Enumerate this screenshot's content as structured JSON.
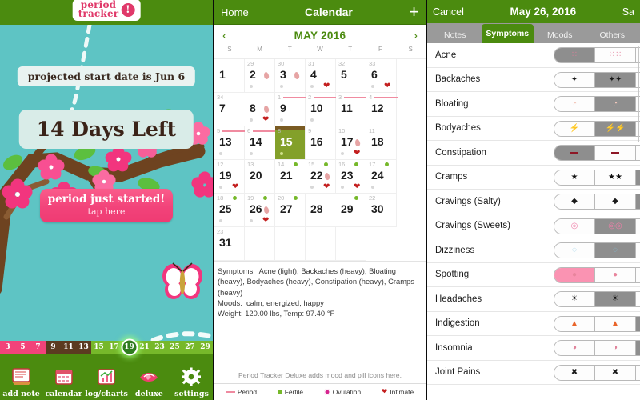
{
  "home": {
    "logo": {
      "line1": "period",
      "line2": "tracker",
      "bang": "!"
    },
    "projected_text": "projected start date is Jun 6",
    "days_left": "14 Days Left",
    "cta_line1": "period just started!",
    "cta_line2": "tap here",
    "cycle_strip": {
      "today": 19,
      "numbers": [
        3,
        5,
        7,
        9,
        11,
        13,
        15,
        17,
        19,
        21,
        23,
        25,
        27,
        29
      ],
      "colors": {
        "period": "#f2437a",
        "luteal": "#5b3b20",
        "fertile": "#76b82a"
      }
    },
    "tabs": [
      {
        "label": "add note",
        "icon": "note-icon"
      },
      {
        "label": "calendar",
        "icon": "calendar-icon"
      },
      {
        "label": "log/charts",
        "icon": "chart-icon"
      },
      {
        "label": "deluxe",
        "icon": "handshake-icon"
      },
      {
        "label": "settings",
        "icon": "gear-icon"
      }
    ]
  },
  "calendar": {
    "back_label": "Home",
    "title": "Calendar",
    "add_label": "+",
    "month": "MAY 2016",
    "prev": "‹",
    "next": "›",
    "dow": [
      "S",
      "M",
      "T",
      "W",
      "T",
      "F",
      "S"
    ],
    "cells": [
      {
        "day": "1",
        "cycle": "",
        "today": false,
        "drop": false,
        "heart": false,
        "graydot": false,
        "gdot": false,
        "pbar": false
      },
      {
        "day": "2",
        "cycle": "29",
        "today": false,
        "drop": true,
        "heart": false,
        "graydot": true,
        "gdot": false,
        "pbar": false
      },
      {
        "day": "3",
        "cycle": "30",
        "today": false,
        "drop": true,
        "heart": false,
        "graydot": true,
        "gdot": false,
        "pbar": false
      },
      {
        "day": "4",
        "cycle": "31",
        "today": false,
        "drop": false,
        "heart": true,
        "graydot": true,
        "gdot": false,
        "pbar": false
      },
      {
        "day": "5",
        "cycle": "32",
        "today": false,
        "drop": false,
        "heart": false,
        "graydot": false,
        "gdot": false,
        "pbar": false
      },
      {
        "day": "6",
        "cycle": "33",
        "today": false,
        "drop": false,
        "heart": true,
        "graydot": true,
        "gdot": false,
        "pbar": false
      },
      {
        "day": "7",
        "cycle": "34",
        "today": false,
        "drop": false,
        "heart": false,
        "graydot": false,
        "gdot": false,
        "pbar": false
      },
      {
        "day": "8",
        "cycle": "",
        "today": false,
        "drop": true,
        "heart": true,
        "graydot": true,
        "gdot": false,
        "pbar": false
      },
      {
        "day": "9",
        "cycle": "1",
        "today": false,
        "drop": false,
        "heart": false,
        "graydot": true,
        "gdot": false,
        "pbar": true
      },
      {
        "day": "10",
        "cycle": "2",
        "today": false,
        "drop": false,
        "heart": false,
        "graydot": true,
        "gdot": false,
        "pbar": true
      },
      {
        "day": "11",
        "cycle": "3",
        "today": false,
        "drop": false,
        "heart": false,
        "graydot": false,
        "gdot": false,
        "pbar": true
      },
      {
        "day": "12",
        "cycle": "4",
        "today": false,
        "drop": false,
        "heart": false,
        "graydot": false,
        "gdot": false,
        "pbar": true
      },
      {
        "day": "13",
        "cycle": "5",
        "today": false,
        "drop": false,
        "heart": false,
        "graydot": true,
        "gdot": false,
        "pbar": true
      },
      {
        "day": "14",
        "cycle": "6",
        "today": false,
        "drop": false,
        "heart": false,
        "graydot": true,
        "gdot": false,
        "pbar": true
      },
      {
        "day": "15",
        "cycle": "8",
        "today": true,
        "drop": false,
        "heart": false,
        "graydot": true,
        "gdot": false,
        "pbar": false
      },
      {
        "day": "16",
        "cycle": "9",
        "today": false,
        "drop": false,
        "heart": false,
        "graydot": false,
        "gdot": false,
        "pbar": false
      },
      {
        "day": "17",
        "cycle": "10",
        "today": false,
        "drop": true,
        "heart": true,
        "graydot": true,
        "gdot": false,
        "pbar": false
      },
      {
        "day": "18",
        "cycle": "11",
        "today": false,
        "drop": false,
        "heart": false,
        "graydot": false,
        "gdot": false,
        "pbar": false
      },
      {
        "day": "19",
        "cycle": "12",
        "today": false,
        "drop": false,
        "heart": true,
        "graydot": true,
        "gdot": false,
        "pbar": false
      },
      {
        "day": "20",
        "cycle": "13",
        "today": false,
        "drop": false,
        "heart": false,
        "graydot": false,
        "gdot": false,
        "pbar": false
      },
      {
        "day": "21",
        "cycle": "14",
        "today": false,
        "drop": false,
        "heart": false,
        "graydot": false,
        "gdot": true,
        "pbar": false
      },
      {
        "day": "22",
        "cycle": "15",
        "today": false,
        "drop": true,
        "heart": true,
        "graydot": true,
        "gdot": true,
        "pbar": false
      },
      {
        "day": "23",
        "cycle": "16",
        "today": false,
        "drop": false,
        "heart": true,
        "graydot": true,
        "gdot": true,
        "pbar": false
      },
      {
        "day": "24",
        "cycle": "17",
        "today": false,
        "drop": false,
        "heart": false,
        "graydot": true,
        "gdot": true,
        "pbar": false
      },
      {
        "day": "25",
        "cycle": "18",
        "today": false,
        "drop": false,
        "heart": false,
        "graydot": true,
        "gdot": true,
        "pbar": false
      },
      {
        "day": "26",
        "cycle": "19",
        "today": false,
        "drop": true,
        "heart": true,
        "graydot": true,
        "gdot": true,
        "pbar": false
      },
      {
        "day": "27",
        "cycle": "20",
        "today": false,
        "drop": false,
        "heart": false,
        "graydot": false,
        "gdot": true,
        "pbar": false
      },
      {
        "day": "28",
        "cycle": "",
        "today": false,
        "drop": false,
        "heart": false,
        "graydot": false,
        "gdot": false,
        "pbar": false
      },
      {
        "day": "29",
        "cycle": "",
        "today": false,
        "drop": false,
        "heart": false,
        "graydot": false,
        "gdot": true,
        "pbar": false
      },
      {
        "day": "30",
        "cycle": "22",
        "today": false,
        "drop": false,
        "heart": false,
        "graydot": false,
        "gdot": false,
        "pbar": false
      },
      {
        "day": "31",
        "cycle": "23",
        "today": false,
        "drop": false,
        "heart": false,
        "graydot": false,
        "gdot": false,
        "pbar": false
      },
      {
        "day": "",
        "cycle": "",
        "today": false,
        "drop": false,
        "heart": false,
        "graydot": false,
        "gdot": false,
        "pbar": false
      },
      {
        "day": "",
        "cycle": "",
        "today": false,
        "drop": false,
        "heart": false,
        "graydot": false,
        "gdot": false,
        "pbar": false
      },
      {
        "day": "",
        "cycle": "",
        "today": false,
        "drop": false,
        "heart": false,
        "graydot": false,
        "gdot": false,
        "pbar": false
      },
      {
        "day": "",
        "cycle": "",
        "today": false,
        "drop": false,
        "heart": false,
        "graydot": false,
        "gdot": false,
        "pbar": false
      }
    ],
    "notes": "Symptoms:  Acne (light), Backaches (heavy), Bloating (heavy), Bodyaches (heavy), Constipation (heavy), Cramps (heavy)\nMoods:  calm, energized, happy\nWeight: 120.00 lbs, Temp: 97.40 °F",
    "deluxe_note": "Period Tracker Deluxe adds mood and pill icons here.",
    "legend": [
      {
        "label": "Period",
        "type": "dash"
      },
      {
        "label": "Fertile",
        "type": "gd"
      },
      {
        "label": "Ovulation",
        "type": "ov"
      },
      {
        "label": "Intimate",
        "type": "ht"
      }
    ]
  },
  "symptoms": {
    "cancel_label": "Cancel",
    "date_title": "May 26, 2016",
    "save_label": "Sa",
    "tabs": [
      {
        "label": "Notes",
        "active": false
      },
      {
        "label": "Symptoms",
        "active": true
      },
      {
        "label": "Moods",
        "active": false
      },
      {
        "label": "Others",
        "active": false
      }
    ],
    "rows": [
      {
        "name": "Acne",
        "selected": 0,
        "icons": [
          "acne-light-icon",
          "acne-medium-icon",
          "acne-heavy-icon"
        ],
        "glyphs": [
          "⁙",
          "⁙⁙",
          "⁙⁙⁙"
        ],
        "color": "#e27d9a",
        "pinksel": false
      },
      {
        "name": "Backaches",
        "selected": 1,
        "icons": [
          "backache-light-icon",
          "backache-medium-icon",
          "backache-heavy-icon"
        ],
        "glyphs": [
          "✦",
          "✦✦",
          "✦✦✦"
        ],
        "color": "#1a1a1a",
        "pinksel": false
      },
      {
        "name": "Bloating",
        "selected": 1,
        "icons": [
          "bloating-light-icon",
          "bloating-medium-icon",
          "bloating-heavy-icon"
        ],
        "glyphs": [
          "◔",
          "◔",
          "◔"
        ],
        "color": "#f3c8bc",
        "pinksel": false
      },
      {
        "name": "Bodyaches",
        "selected": 1,
        "icons": [
          "bodyache-light-icon",
          "bodyache-medium-icon",
          "bodyache-heavy-icon"
        ],
        "glyphs": [
          "⚡",
          "⚡⚡",
          "⚡⚡⚡"
        ],
        "color": "#d2456b",
        "pinksel": false
      },
      {
        "name": "Constipation",
        "selected": 0,
        "icons": [
          "constipation-light-icon",
          "constipation-medium-icon",
          "constipation-heavy-icon"
        ],
        "glyphs": [
          "▬",
          "▬",
          "▬"
        ],
        "color": "#8e1726",
        "pinksel": false
      },
      {
        "name": "Cramps",
        "selected": 2,
        "icons": [
          "cramps-light-icon",
          "cramps-medium-icon",
          "cramps-heavy-icon"
        ],
        "glyphs": [
          "★",
          "★★",
          "★★★"
        ],
        "color": "#111111",
        "pinksel": false
      },
      {
        "name": "Cravings (Salty)",
        "selected": 2,
        "icons": [
          "salty-light-icon",
          "salty-medium-icon",
          "salty-heavy-icon"
        ],
        "glyphs": [
          "◆",
          "◆",
          "◆"
        ],
        "color": "#1a1a1a",
        "pinksel": false
      },
      {
        "name": "Cravings (Sweets)",
        "selected": 1,
        "icons": [
          "sweets-light-icon",
          "sweets-medium-icon",
          "sweets-heavy-icon"
        ],
        "glyphs": [
          "◎",
          "◎◎",
          "◎◎◎"
        ],
        "color": "#ef7fa8",
        "pinksel": false
      },
      {
        "name": "Dizziness",
        "selected": 1,
        "icons": [
          "dizzy-light-icon",
          "dizzy-medium-icon",
          "dizzy-heavy-icon"
        ],
        "glyphs": [
          "◌",
          "◌",
          "◎"
        ],
        "color": "#7fc4e0",
        "pinksel": false
      },
      {
        "name": "Spotting",
        "selected": 0,
        "icons": [
          "spotting-light-icon",
          "spotting-medium-icon",
          "spotting-heavy-icon"
        ],
        "glyphs": [
          "●",
          "●",
          "●"
        ],
        "color": "#e8849c",
        "pinksel": true
      },
      {
        "name": "Headaches",
        "selected": 1,
        "icons": [
          "headache-light-icon",
          "headache-medium-icon",
          "headache-heavy-icon"
        ],
        "glyphs": [
          "☀",
          "☀",
          "☀"
        ],
        "color": "#111111",
        "pinksel": false
      },
      {
        "name": "Indigestion",
        "selected": 2,
        "icons": [
          "indigestion-light-icon",
          "indigestion-medium-icon",
          "indigestion-heavy-icon"
        ],
        "glyphs": [
          "▲",
          "▲",
          "▲"
        ],
        "color": "#e9642a",
        "pinksel": false
      },
      {
        "name": "Insomnia",
        "selected": 2,
        "icons": [
          "insomnia-light-icon",
          "insomnia-medium-icon",
          "insomnia-heavy-icon"
        ],
        "glyphs": [
          "◑",
          "◑",
          "◑"
        ],
        "color": "#e0839b",
        "pinksel": false
      },
      {
        "name": "Joint Pains",
        "selected": -1,
        "icons": [
          "joint-light-icon",
          "joint-medium-icon",
          "joint-heavy-icon"
        ],
        "glyphs": [
          "✖",
          "✖",
          "✖"
        ],
        "color": "#1a1a1a",
        "pinksel": false
      }
    ]
  }
}
